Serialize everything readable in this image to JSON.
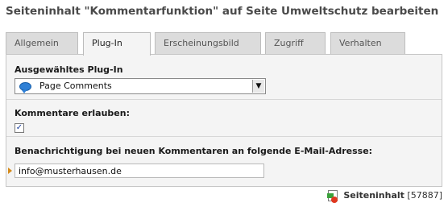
{
  "page": {
    "title": "Seiteninhalt \"Kommentarfunktion\" auf Seite Umweltschutz bearbeiten"
  },
  "tabs": [
    {
      "label": "Allgemein",
      "active": false
    },
    {
      "label": "Plug-In",
      "active": true
    },
    {
      "label": "Erscheinungsbild",
      "active": false
    },
    {
      "label": "Zugriff",
      "active": false
    },
    {
      "label": "Verhalten",
      "active": false
    }
  ],
  "plugin_section": {
    "label": "Ausgewähltes Plug-In",
    "selected_value": "Page Comments",
    "icon": "comment-bubble-icon"
  },
  "comments_section": {
    "label": "Kommentare erlauben:",
    "checked": true
  },
  "notification_section": {
    "label": "Benachrichtigung bei neuen Kommentaren an folgende E-Mail-Adresse:",
    "email_value": "info@musterhausen.de"
  },
  "footer": {
    "type_label": "Seiteninhalt",
    "id_label": "[57887]",
    "icon": "content-element-icon"
  },
  "colors": {
    "tab_active": "#f4f4f4",
    "tab_inactive": "#dcdcdc",
    "panel": "#f4f4f4",
    "required_marker": "#d58a1a"
  }
}
